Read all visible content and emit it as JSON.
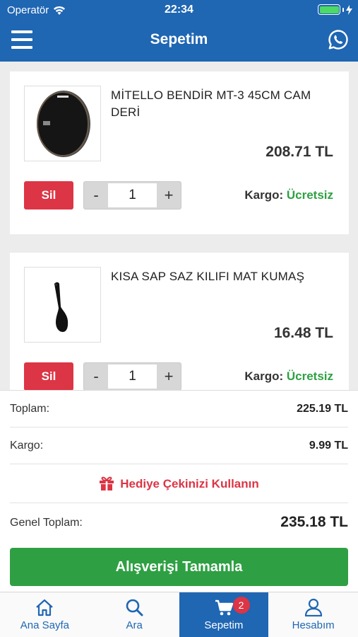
{
  "status_bar": {
    "carrier": "Operatör",
    "time": "22:34"
  },
  "header": {
    "title": "Sepetim"
  },
  "icons": {
    "menu": "hamburger-menu-icon",
    "whatsapp": "whatsapp-icon",
    "wifi": "wifi-icon",
    "battery": "battery-icon",
    "charging": "charging-bolt-icon"
  },
  "cart_items": [
    {
      "name": "MİTELLO BENDİR MT-3  45CM CAM DERİ",
      "price": "208.71 TL",
      "remove_label": "Sil",
      "quantity": "1",
      "minus": "-",
      "plus": "+",
      "shipping_label": "Kargo:",
      "shipping_value": "Ücretsiz"
    },
    {
      "name": "KISA SAP SAZ KILIFI MAT KUMAŞ",
      "price": "16.48 TL",
      "remove_label": "Sil",
      "quantity": "1",
      "minus": "-",
      "plus": "+",
      "shipping_label": "Kargo:",
      "shipping_value": "Ücretsiz"
    }
  ],
  "summary": {
    "subtotal_label": "Toplam:",
    "subtotal_value": "225.19 TL",
    "shipping_label": "Kargo:",
    "shipping_value": "9.99 TL",
    "gift_label": "Hediye Çekinizi Kullanın",
    "total_label": "Genel Toplam:",
    "total_value": "235.18 TL",
    "checkout_label": "Alışverişi Tamamla"
  },
  "tabbar": {
    "items": [
      {
        "label": "Ana Sayfa",
        "icon": "home-icon"
      },
      {
        "label": "Ara",
        "icon": "search-icon"
      },
      {
        "label": "Sepetim",
        "icon": "cart-icon",
        "badge": "2",
        "active": true
      },
      {
        "label": "Hesabım",
        "icon": "user-icon"
      }
    ]
  },
  "colors": {
    "primary": "#1f66b3",
    "danger": "#dc3545",
    "success": "#2ea043"
  }
}
